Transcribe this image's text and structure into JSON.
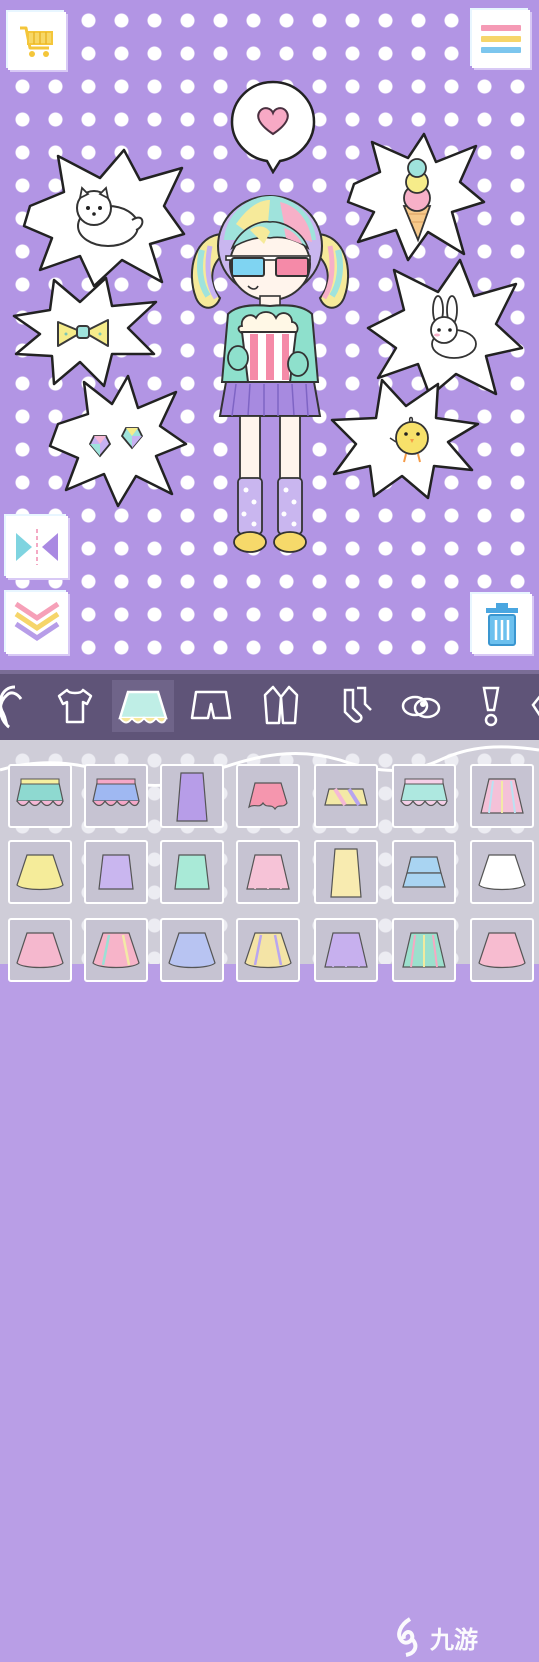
{
  "app": {
    "watermark_text": "九游"
  },
  "top_buttons": {
    "cart_icon": "shopping-cart-icon",
    "menu_icon": "hamburger-menu-icon"
  },
  "side_buttons": {
    "mirror_icon": "mirror-flip-icon",
    "collapse_icon": "chevron-down-icon",
    "trash_icon": "trash-icon"
  },
  "bubbles": [
    {
      "name": "dog-item",
      "icon": "white-dog-icon"
    },
    {
      "name": "bow-item",
      "icon": "yellow-bow-icon"
    },
    {
      "name": "gems-item",
      "icon": "gem-earrings-icon"
    },
    {
      "name": "icecream-item",
      "icon": "ice-cream-icon"
    },
    {
      "name": "bunny-item",
      "icon": "bunny-icon"
    },
    {
      "name": "chick-item",
      "icon": "chick-icon"
    },
    {
      "name": "heart-bubble",
      "icon": "heart-icon"
    }
  ],
  "category_tabs": [
    {
      "name": "hair",
      "icon": "hair-icon"
    },
    {
      "name": "top",
      "icon": "tshirt-icon"
    },
    {
      "name": "skirt",
      "icon": "skirt-icon",
      "active": true
    },
    {
      "name": "shorts",
      "icon": "shorts-icon"
    },
    {
      "name": "coat",
      "icon": "coat-icon"
    },
    {
      "name": "socks",
      "icon": "socks-icon"
    },
    {
      "name": "shoes",
      "icon": "shoes-icon"
    },
    {
      "name": "accessory",
      "icon": "accessory-icon"
    }
  ],
  "skirt_items": [
    {
      "colors": [
        "#8ed9d0",
        "#f5b8d6",
        "#f6f0a0"
      ],
      "style": "tutu"
    },
    {
      "colors": [
        "#9fb8f2",
        "#f5a8c8"
      ],
      "style": "tutu"
    },
    {
      "colors": [
        "#b79de8"
      ],
      "style": "long"
    },
    {
      "colors": [
        "#f596ae"
      ],
      "style": "scallop"
    },
    {
      "colors": [
        "#f3e9a6",
        "#f5b8d6",
        "#b7a4ef"
      ],
      "style": "mini"
    },
    {
      "colors": [
        "#aee8e0",
        "#f5d0e8"
      ],
      "style": "ruffle"
    },
    {
      "colors": [
        "#f4c1d8",
        "#b9e2f3",
        "#f3e9a6"
      ],
      "style": "pleated"
    },
    {
      "colors": [
        "#f5ec9a"
      ],
      "style": "flare"
    },
    {
      "colors": [
        "#c9b6ef"
      ],
      "style": "straight"
    },
    {
      "colors": [
        "#a9ead7"
      ],
      "style": "straight"
    },
    {
      "colors": [
        "#f6c3d7"
      ],
      "style": "pleated"
    },
    {
      "colors": [
        "#f8ebb0"
      ],
      "style": "long"
    },
    {
      "colors": [
        "#a9d4f2"
      ],
      "style": "tiered"
    },
    {
      "colors": [
        "#ffffff"
      ],
      "style": "flare"
    },
    {
      "colors": [
        "#f5b8ce"
      ],
      "style": "flare"
    },
    {
      "colors": [
        "#f7b4c9",
        "#9be0d5",
        "#f3e9a6"
      ],
      "style": "flare"
    },
    {
      "colors": [
        "#b8c4f2"
      ],
      "style": "flare"
    },
    {
      "colors": [
        "#f4e4a6",
        "#b9a6f0"
      ],
      "style": "flare"
    },
    {
      "colors": [
        "#c7b0ee"
      ],
      "style": "pleated"
    },
    {
      "colors": [
        "#9ce0cd",
        "#f5a8c3",
        "#f1ea9e"
      ],
      "style": "pleated"
    },
    {
      "colors": [
        "#f7bcd0"
      ],
      "style": "flare"
    }
  ]
}
